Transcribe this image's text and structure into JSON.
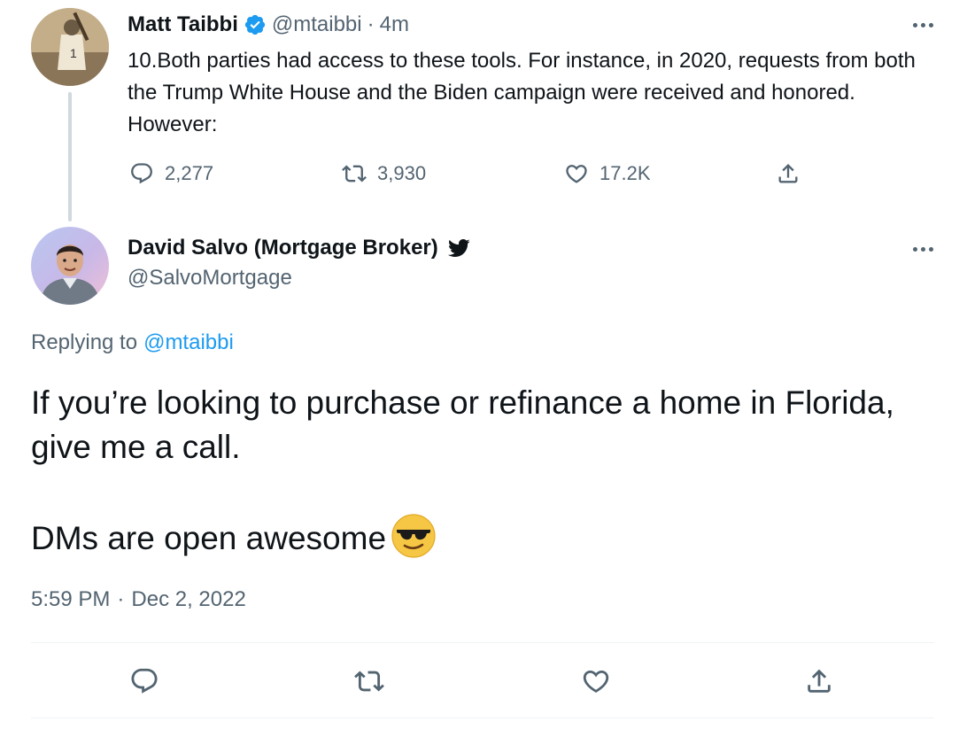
{
  "parent_tweet": {
    "author_name": "Matt Taibbi",
    "handle": "@mtaibbi",
    "separator": "·",
    "time_ago": "4m",
    "text": "10.Both parties had access to these tools. For instance, in 2020, requests from both the Trump White House and the Biden campaign were received and honored. However:",
    "stats": {
      "replies": "2,277",
      "retweets": "3,930",
      "likes": "17.2K"
    }
  },
  "reply_tweet": {
    "author_name": "David Salvo (Mortgage Broker)",
    "handle": "@SalvoMortgage",
    "replying_prefix": "Replying to",
    "replying_to": "@mtaibbi",
    "text_line_1": "If you’re looking to purchase or refinance a home in Florida, give me a call.",
    "text_line_2": "",
    "text_line_3": "DMs are open awesome",
    "time": "5:59 PM",
    "separator": "·",
    "date": "Dec 2, 2022"
  },
  "colors": {
    "primary_text": "#0f1419",
    "secondary_text": "#536471",
    "link": "#1d9bf0",
    "verified_badge": "#1d9bf0",
    "divider": "#eff3f4",
    "thread_line": "#cfd9de"
  },
  "icons": {
    "verified": "verified-badge-icon",
    "twitter_bird": "twitter-bird-icon",
    "reply": "reply-icon",
    "retweet": "retweet-icon",
    "like": "heart-icon",
    "share": "share-icon",
    "more": "more-dots-icon",
    "emoji": "sunglasses-emoji-icon"
  }
}
